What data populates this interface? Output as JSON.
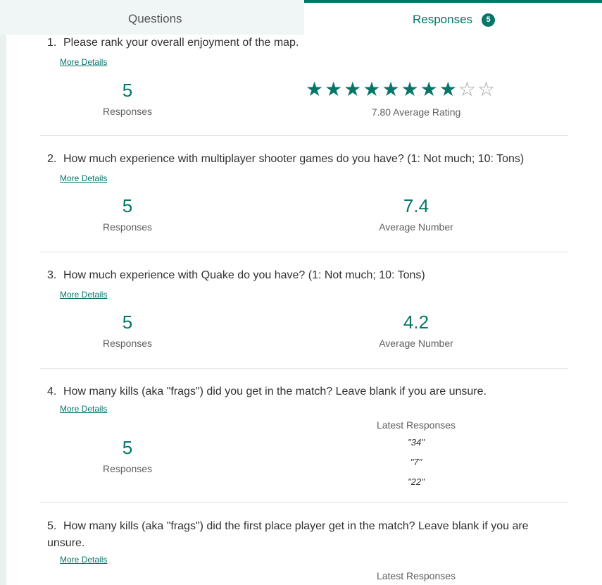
{
  "tabs": {
    "questions_label": "Questions",
    "responses_label": "Responses",
    "responses_count": "5"
  },
  "questions": [
    {
      "number": "1.",
      "title": "Please rank your overall enjoyment of the map.",
      "more_details": "More Details",
      "responses_count": "5",
      "responses_label": "Responses",
      "rating": {
        "filled_stars": 8,
        "max_stars": 10,
        "average_text": "7.80 Average Rating"
      }
    },
    {
      "number": "2.",
      "title": "How much experience with multiplayer shooter games do you have? (1: Not much; 10: Tons)",
      "more_details": "More Details",
      "responses_count": "5",
      "responses_label": "Responses",
      "average_value": "7.4",
      "average_label": "Average Number"
    },
    {
      "number": "3.",
      "title": "How much experience with Quake do you have? (1: Not much; 10: Tons)",
      "more_details": "More Details",
      "responses_count": "5",
      "responses_label": "Responses",
      "average_value": "4.2",
      "average_label": "Average Number"
    },
    {
      "number": "4.",
      "title": "How many kills (aka \"frags\") did you get in the match? Leave blank if you are unsure.",
      "more_details": "More Details",
      "responses_count": "5",
      "responses_label": "Responses",
      "latest_label": "Latest Responses",
      "latest": [
        "\"34\"",
        "\"7\"",
        "\"22\""
      ]
    },
    {
      "number": "5.",
      "title": "How many kills (aka \"frags\") did the first place player get in the match? Leave blank if you are unsure.",
      "more_details": "More Details",
      "latest_label": "Latest Responses"
    }
  ],
  "colors": {
    "accent": "#077568",
    "star_empty": "#a0a0a0",
    "divider": "#e1dfdd"
  },
  "icons": {
    "star_filled": "star-filled-icon",
    "star_empty": "star-outline-icon"
  }
}
